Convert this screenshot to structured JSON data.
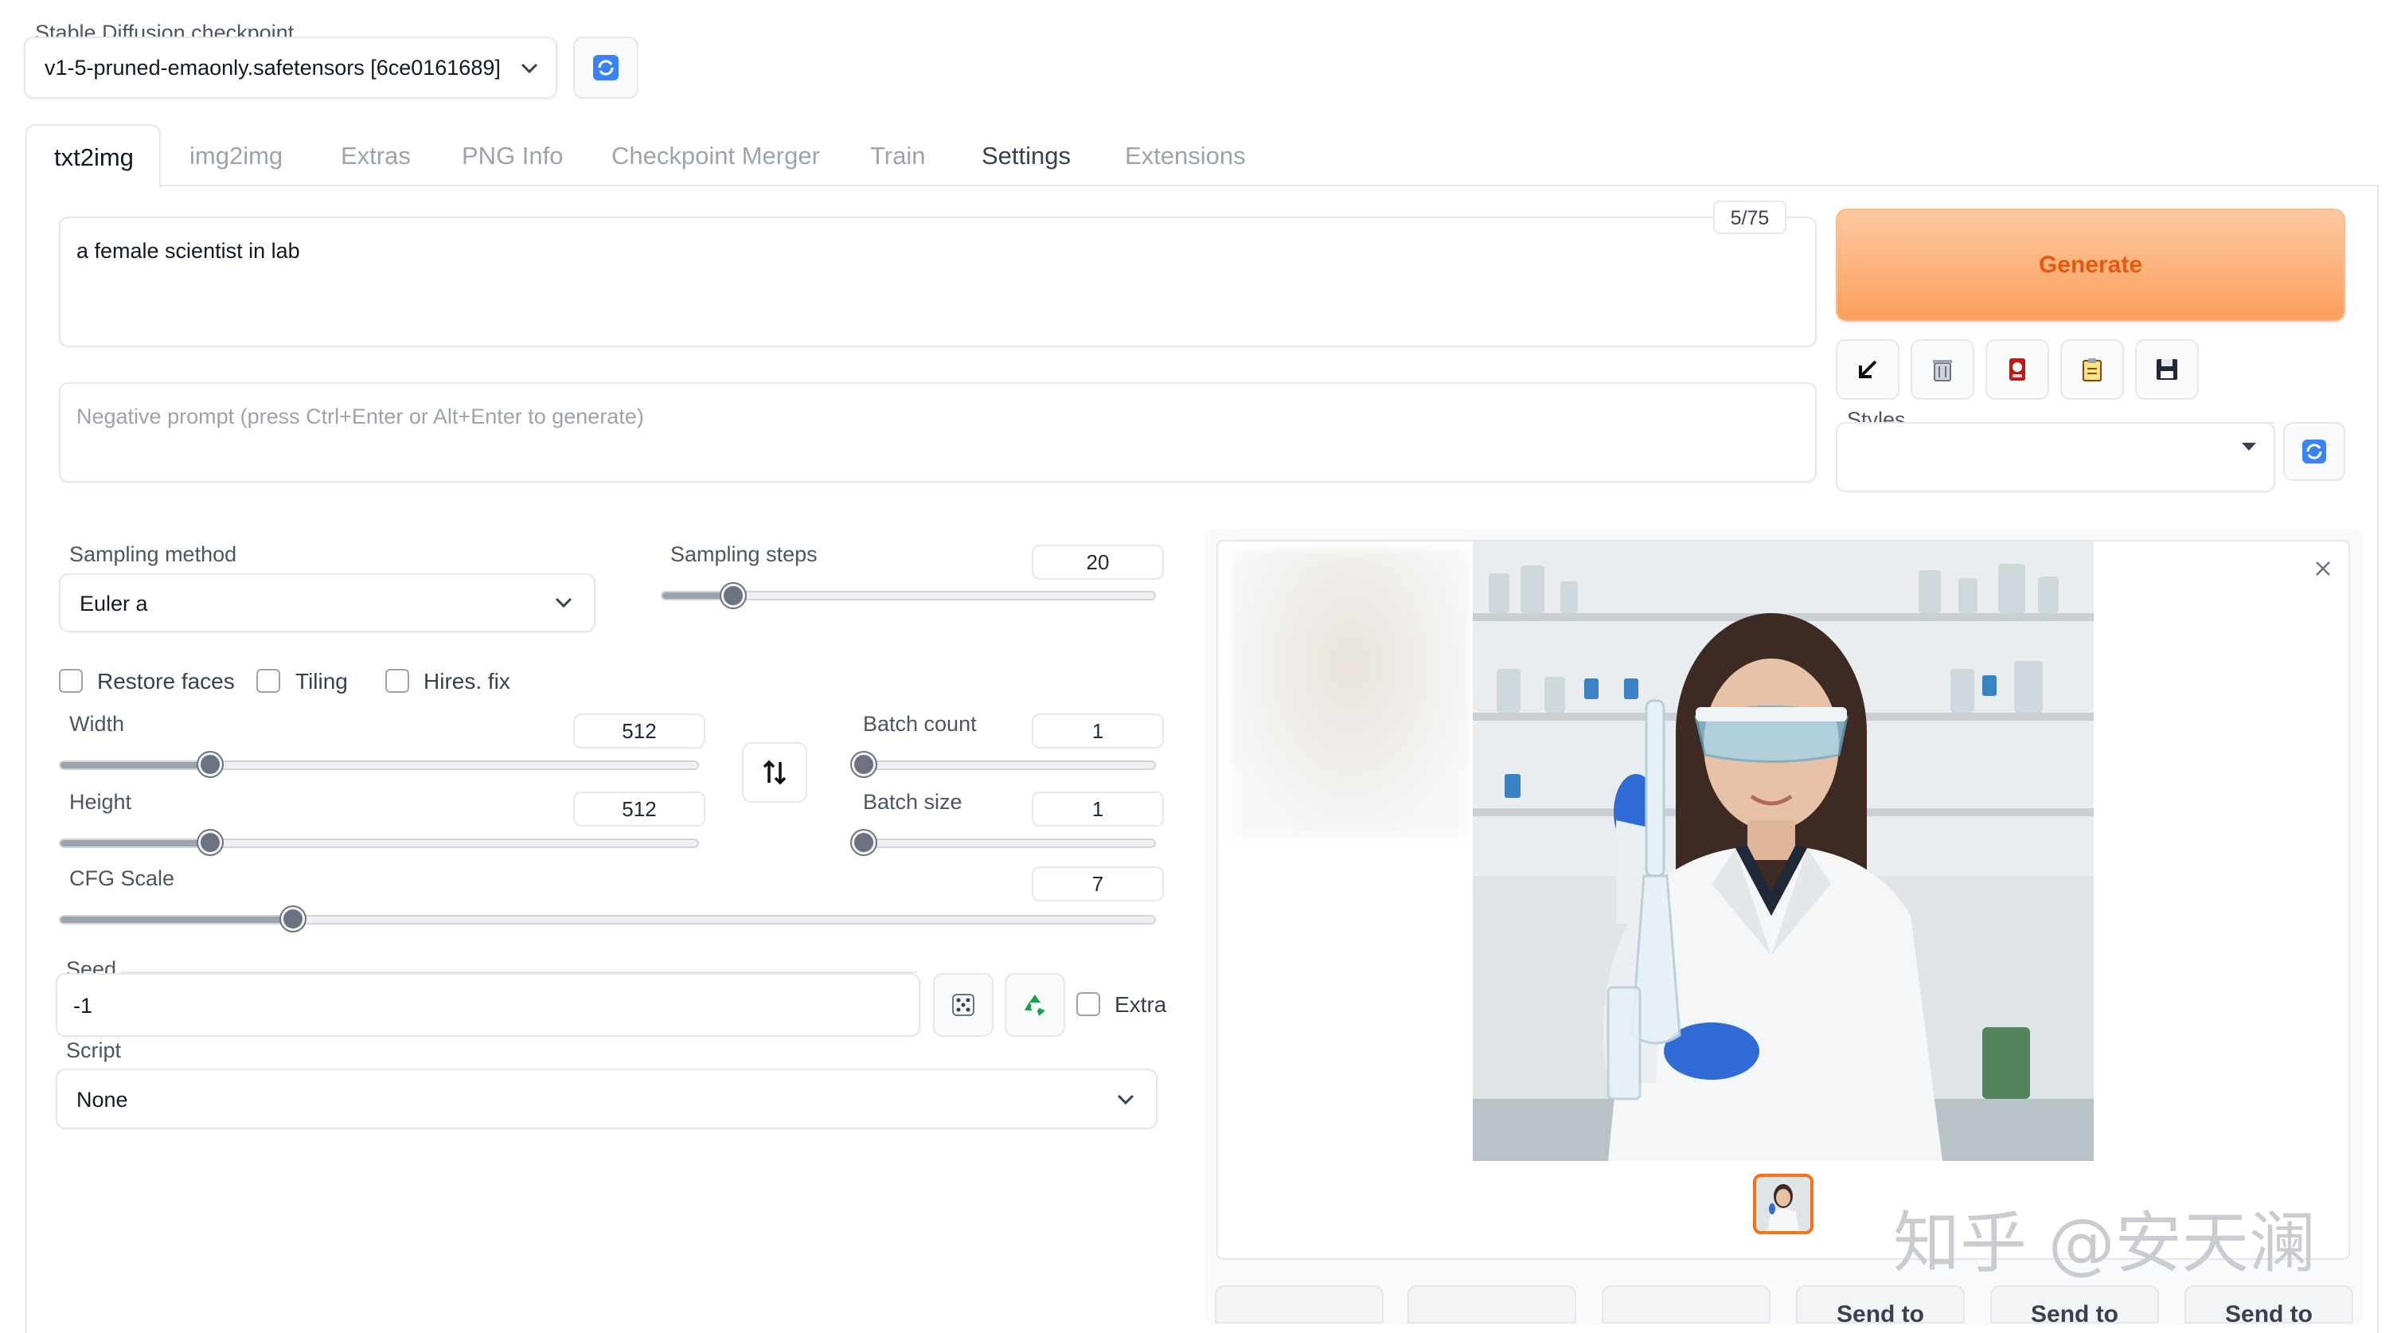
{
  "checkpoint": {
    "label": "Stable Diffusion checkpoint",
    "value": "v1-5-pruned-emaonly.safetensors [6ce0161689]"
  },
  "tabs": [
    "txt2img",
    "img2img",
    "Extras",
    "PNG Info",
    "Checkpoint Merger",
    "Train",
    "Settings",
    "Extensions"
  ],
  "prompt": {
    "value": "a female scientist in lab",
    "token_counter": "5/75",
    "negative_placeholder": "Negative prompt (press Ctrl+Enter or Alt+Enter to generate)"
  },
  "generate_label": "Generate",
  "styles_label": "Styles",
  "sampling": {
    "method_label": "Sampling method",
    "method_value": "Euler a",
    "steps_label": "Sampling steps",
    "steps_value": "20"
  },
  "checkboxes": {
    "restore_faces": "Restore faces",
    "tiling": "Tiling",
    "hires_fix": "Hires. fix"
  },
  "width": {
    "label": "Width",
    "value": "512"
  },
  "height": {
    "label": "Height",
    "value": "512"
  },
  "batch_count": {
    "label": "Batch count",
    "value": "1"
  },
  "batch_size": {
    "label": "Batch size",
    "value": "1"
  },
  "cfg": {
    "label": "CFG Scale",
    "value": "7"
  },
  "seed": {
    "label": "Seed",
    "value": "-1",
    "extra_label": "Extra"
  },
  "script": {
    "label": "Script",
    "value": "None"
  },
  "send_buttons": [
    "Send to",
    "Send to",
    "Send to"
  ],
  "watermark": "知乎 @安天澜",
  "colors": {
    "generate_gradient_start": "#fdba8c",
    "generate_gradient_end": "#fb923c",
    "generate_text": "#ea580c",
    "accent": "#f97316"
  }
}
